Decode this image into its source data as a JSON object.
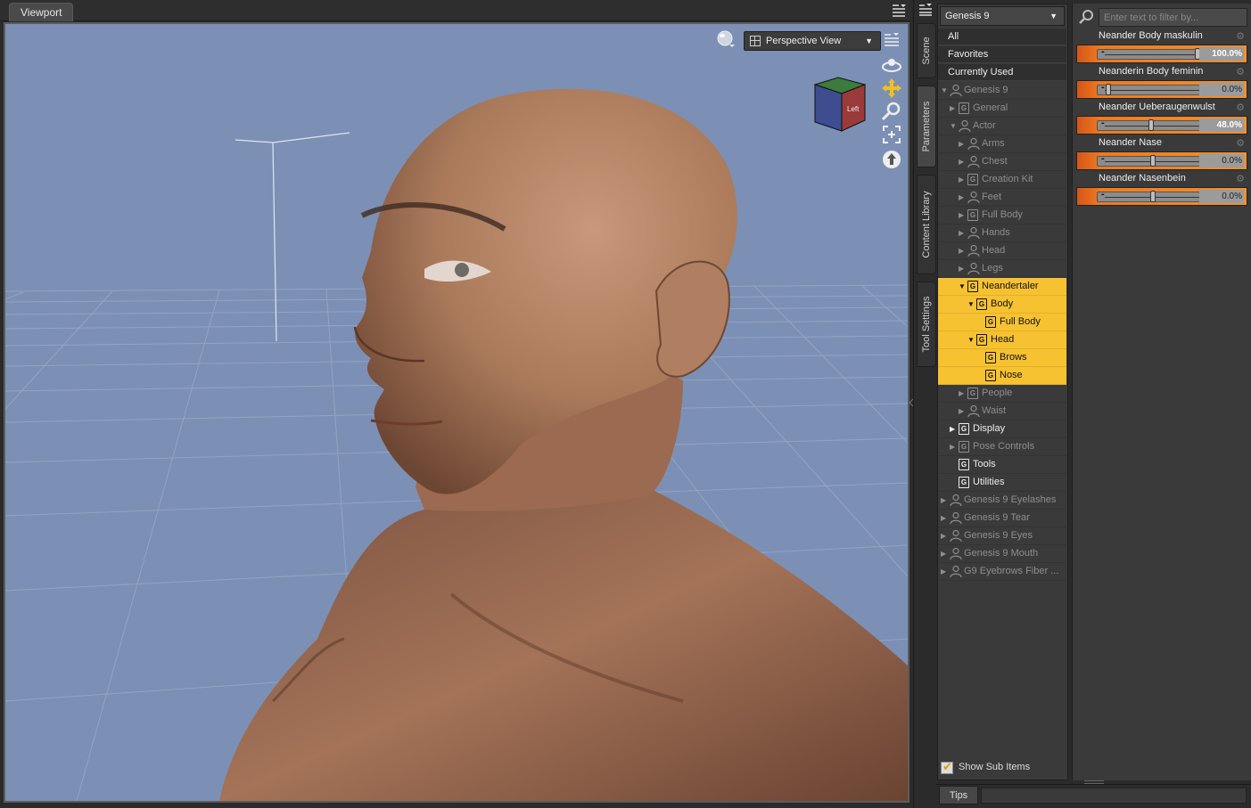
{
  "viewport": {
    "tab_label": "Viewport",
    "view_mode": "Perspective View",
    "cube_face_label": "Left"
  },
  "side_tabs": [
    "Scene",
    "Parameters",
    "Content Library",
    "Tool Settings"
  ],
  "tree": {
    "figure_selector": "Genesis 9",
    "presets": [
      "All",
      "Favorites",
      "Currently Used"
    ],
    "nodes": [
      {
        "label": "Genesis 9"
      },
      {
        "label": "General"
      },
      {
        "label": "Actor"
      },
      {
        "label": "Arms"
      },
      {
        "label": "Chest"
      },
      {
        "label": "Creation Kit"
      },
      {
        "label": "Feet"
      },
      {
        "label": "Full Body"
      },
      {
        "label": "Hands"
      },
      {
        "label": "Head"
      },
      {
        "label": "Legs"
      },
      {
        "label": "Neandertaler"
      },
      {
        "label": "Body"
      },
      {
        "label": "Full Body"
      },
      {
        "label": "Head"
      },
      {
        "label": "Brows"
      },
      {
        "label": "Nose"
      },
      {
        "label": "People"
      },
      {
        "label": "Waist"
      },
      {
        "label": "Display"
      },
      {
        "label": "Pose Controls"
      },
      {
        "label": "Tools"
      },
      {
        "label": "Utilities"
      },
      {
        "label": "Genesis 9 Eyelashes"
      },
      {
        "label": "Genesis 9 Tear"
      },
      {
        "label": "Genesis 9 Eyes"
      },
      {
        "label": "Genesis 9 Mouth"
      },
      {
        "label": "G9 Eyebrows Fiber ..."
      }
    ],
    "show_sub_items": {
      "label": "Show Sub Items",
      "checked": true
    }
  },
  "properties": {
    "filter_placeholder": "Enter text to filter by...",
    "sliders": [
      {
        "name": "Neander Body maskulin",
        "value_text": "100.0%",
        "fraction": 1.0,
        "active": true
      },
      {
        "name": "Neanderin Body feminin",
        "value_text": "0.0%",
        "fraction": 0.0,
        "active": false
      },
      {
        "name": "Neander Ueberaugenwulst",
        "value_text": "48.0%",
        "fraction": 0.48,
        "active": true
      },
      {
        "name": "Neander Nase",
        "value_text": "0.0%",
        "fraction": 0.5,
        "active": false
      },
      {
        "name": "Neander Nasenbein",
        "value_text": "0.0%",
        "fraction": 0.5,
        "active": false
      }
    ],
    "minus_symbol": "-",
    "plus_symbol": "+"
  },
  "tips": {
    "tab_label": "Tips"
  },
  "colors": {
    "viewport_background": "#7c90b5",
    "highlight": "#f6c232",
    "slider_fill": "#ef7a1f",
    "panel": "#3a3a3a"
  },
  "icons": [
    "render-sphere-icon",
    "grid-view-icon",
    "options-menu-icon",
    "orbit-icon",
    "translate-icon",
    "zoom-icon",
    "frame-icon",
    "reset-view-icon",
    "view-cube-icon",
    "figure-icon",
    "group-icon",
    "gear-icon",
    "search-icon"
  ]
}
